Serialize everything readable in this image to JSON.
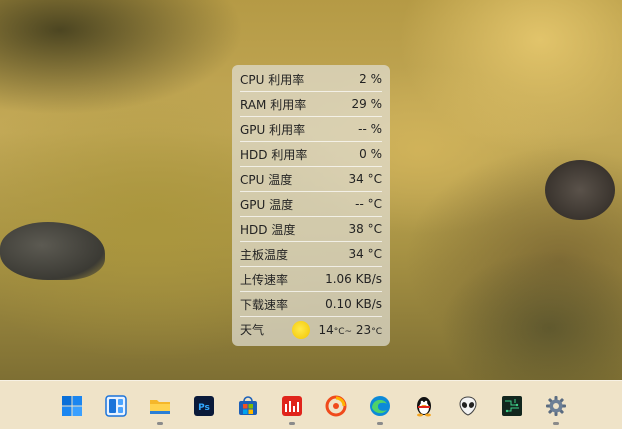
{
  "monitor": {
    "rows": [
      {
        "label": "CPU 利用率",
        "value": "2 %"
      },
      {
        "label": "RAM 利用率",
        "value": "29 %"
      },
      {
        "label": "GPU 利用率",
        "value": "-- %"
      },
      {
        "label": "HDD 利用率",
        "value": "0 %"
      },
      {
        "label": "CPU 温度",
        "value": "34 °C"
      },
      {
        "label": "GPU 温度",
        "value": "-- °C"
      },
      {
        "label": "HDD 温度",
        "value": "38 °C"
      },
      {
        "label": "主板温度",
        "value": "34 °C"
      },
      {
        "label": "上传速率",
        "value": "1.06 KB/s"
      },
      {
        "label": "下载速率",
        "value": "0.10 KB/s"
      }
    ],
    "weather": {
      "label": "天气",
      "low": "14",
      "low_unit": "°C~",
      "high": "23",
      "high_unit": "°C",
      "icon": "sun-icon"
    }
  },
  "taskbar": {
    "items": [
      {
        "name": "start-button",
        "icon": "windows-logo-icon",
        "running": false
      },
      {
        "name": "widgets-button",
        "icon": "widgets-icon",
        "running": false
      },
      {
        "name": "file-explorer-button",
        "icon": "folder-icon",
        "running": true
      },
      {
        "name": "photoshop-button",
        "icon": "photoshop-icon",
        "running": false
      },
      {
        "name": "store-button",
        "icon": "store-icon",
        "running": false
      },
      {
        "name": "stock-app-button",
        "icon": "stock-chart-icon",
        "running": true
      },
      {
        "name": "app-orange-button",
        "icon": "orange-swirl-icon",
        "running": false
      },
      {
        "name": "edge-button",
        "icon": "edge-icon",
        "running": true
      },
      {
        "name": "qq-button",
        "icon": "penguin-icon",
        "running": false
      },
      {
        "name": "alien-app-button",
        "icon": "alien-icon",
        "running": false
      },
      {
        "name": "monitor-app-button",
        "icon": "circuit-icon",
        "running": false
      },
      {
        "name": "settings-button",
        "icon": "gear-icon",
        "running": true
      }
    ]
  },
  "colors": {
    "taskbar_bg": "#efe3c8",
    "accent_blue": "#0a6fd8",
    "photoshop_bg": "#0a1a3a",
    "photoshop_fg": "#31a8ff",
    "sun": "#f3c400"
  }
}
